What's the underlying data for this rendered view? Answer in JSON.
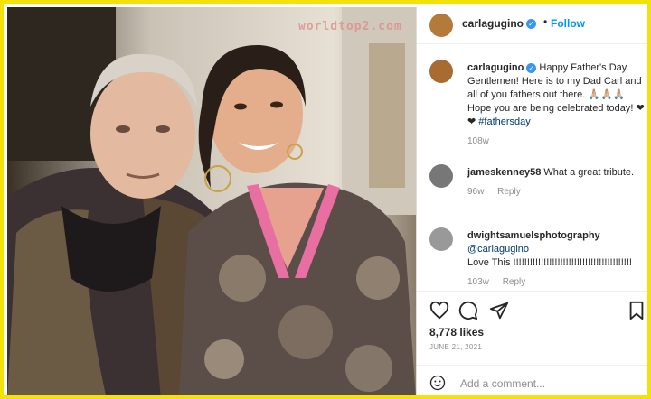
{
  "watermark": "worldtop2.com",
  "post": {
    "username": "carlagugino",
    "follow_label": "Follow",
    "separator": "•",
    "caption_text": "Happy Father's Day Gentlemen! Here is to my Dad Carl and all of you fathers out there. 🙏🏼🙏🏼🙏🏼 Hope you are being celebrated today! ❤❤",
    "caption_hashtag": "#fathersday",
    "caption_age": "108w",
    "likes": "8,778 likes",
    "date": "JUNE 21, 2021"
  },
  "comments": [
    {
      "username": "jameskenney58",
      "text": "What a great tribute.",
      "age": "96w",
      "reply": "Reply"
    },
    {
      "username": "dwightsamuelsphotography",
      "mention": "@carlagugino",
      "text": "Love This !!!!!!!!!!!!!!!!!!!!!!!!!!!!!!!!!!!!!!!!!!!",
      "age": "103w",
      "reply": "Reply"
    }
  ],
  "actions": {
    "like": "heart-icon",
    "comment": "comment-icon",
    "share": "share-icon",
    "save": "bookmark-icon"
  },
  "add_comment": {
    "placeholder": "Add a comment...",
    "emoji": "smiley-icon"
  },
  "colors": {
    "accent": "#0095f6",
    "verified": "#3897f0",
    "frame": "#f2e20a"
  }
}
